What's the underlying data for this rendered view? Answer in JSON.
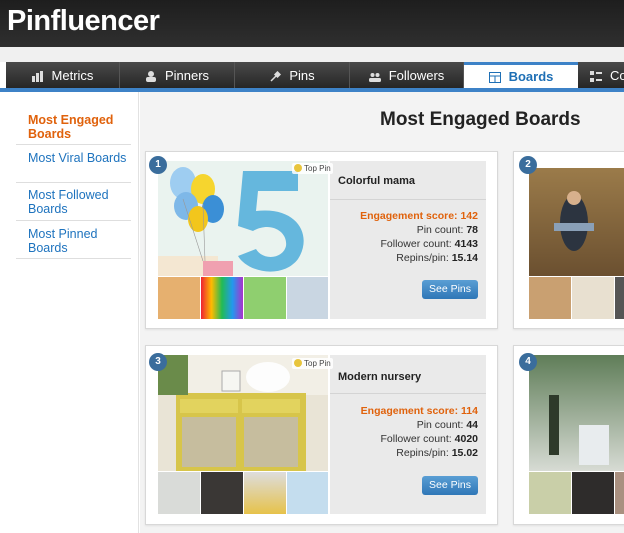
{
  "app": {
    "title": "Pinfluencer"
  },
  "nav": {
    "tabs": [
      {
        "label": "Metrics",
        "icon": "bar-chart-icon"
      },
      {
        "label": "Pinners",
        "icon": "person-icon"
      },
      {
        "label": "Pins",
        "icon": "pin-icon"
      },
      {
        "label": "Followers",
        "icon": "people-icon"
      },
      {
        "label": "Boards",
        "icon": "board-icon"
      },
      {
        "label": "Co",
        "icon": "grid-icon"
      }
    ],
    "active": "Boards"
  },
  "sidebar": {
    "items": [
      {
        "label": "Most Engaged Boards",
        "active": true
      },
      {
        "label": "Most Viral Boards",
        "active": false
      },
      {
        "label": "Most Followed Boards",
        "active": false
      },
      {
        "label": "Most Pinned Boards",
        "active": false
      }
    ]
  },
  "page": {
    "title": "Most Engaged Boards"
  },
  "boards": [
    {
      "rank": "1",
      "name": "Colorful mama",
      "top_pin": "Top Pin",
      "engagement_label": "Engagement score:",
      "engagement": "142",
      "pin_count_label": "Pin count:",
      "pin_count": "78",
      "follower_label": "Follower count:",
      "follower_count": "4143",
      "repins_label": "Repins/pin:",
      "repins": "15.14",
      "button": "See Pins"
    },
    {
      "rank": "2"
    },
    {
      "rank": "3",
      "name": "Modern nursery",
      "top_pin": "Top Pin",
      "engagement_label": "Engagement score:",
      "engagement": "114",
      "pin_count_label": "Pin count:",
      "pin_count": "44",
      "follower_label": "Follower count:",
      "follower_count": "4020",
      "repins_label": "Repins/pin:",
      "repins": "15.02",
      "button": "See Pins"
    },
    {
      "rank": "4"
    }
  ],
  "colors": {
    "accent": "#3d82c7",
    "engagement": "#e0620c",
    "link": "#1e73be",
    "header": "#2a2a2a"
  }
}
